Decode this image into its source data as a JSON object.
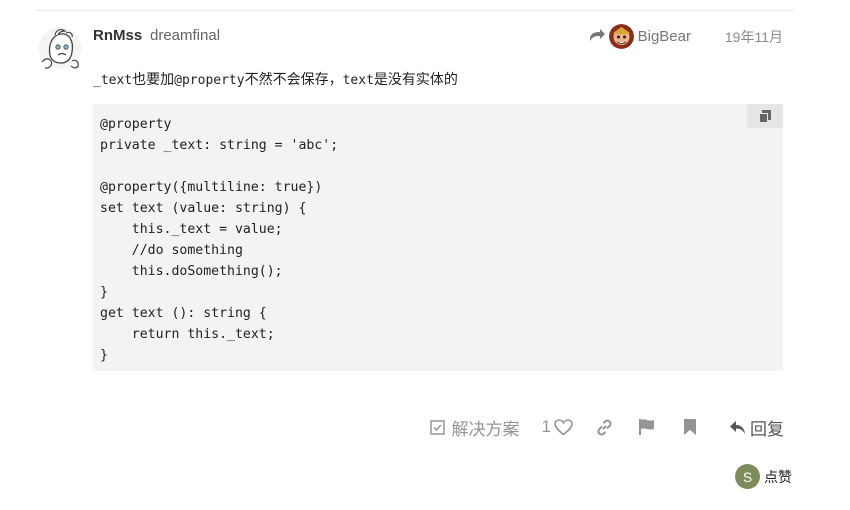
{
  "post": {
    "username": "RnMss",
    "fullname": "dreamfinal",
    "reply_to": {
      "name": "BigBear",
      "icon": "reply-arrow-icon"
    },
    "date": "19年11月",
    "text_parts": [
      {
        "code": "_text"
      },
      {
        "text": "也要加"
      },
      {
        "code": "@property"
      },
      {
        "text": "不然不会保存，"
      },
      {
        "code": "text"
      },
      {
        "text": "是没有实体的"
      }
    ],
    "code_lines": [
      "@property",
      "private _text: string = 'abc';",
      "",
      "@property({multiline: true})",
      "set text (value: string) {",
      "    this._text = value;",
      "    //do something",
      "    this.doSomething();",
      "}",
      "get text (): string {",
      "    return this._text;",
      "}"
    ]
  },
  "actions": {
    "solution_label": "解决方案",
    "like_count": "1",
    "reply_label": "回复",
    "icons": [
      "checkbox-icon",
      "heart-icon",
      "link-icon",
      "flag-icon",
      "bookmark-icon",
      "reply-icon"
    ]
  },
  "likers": {
    "avatar_letter": "S",
    "avatar_color": "#7d8c5a",
    "label": "点赞"
  }
}
